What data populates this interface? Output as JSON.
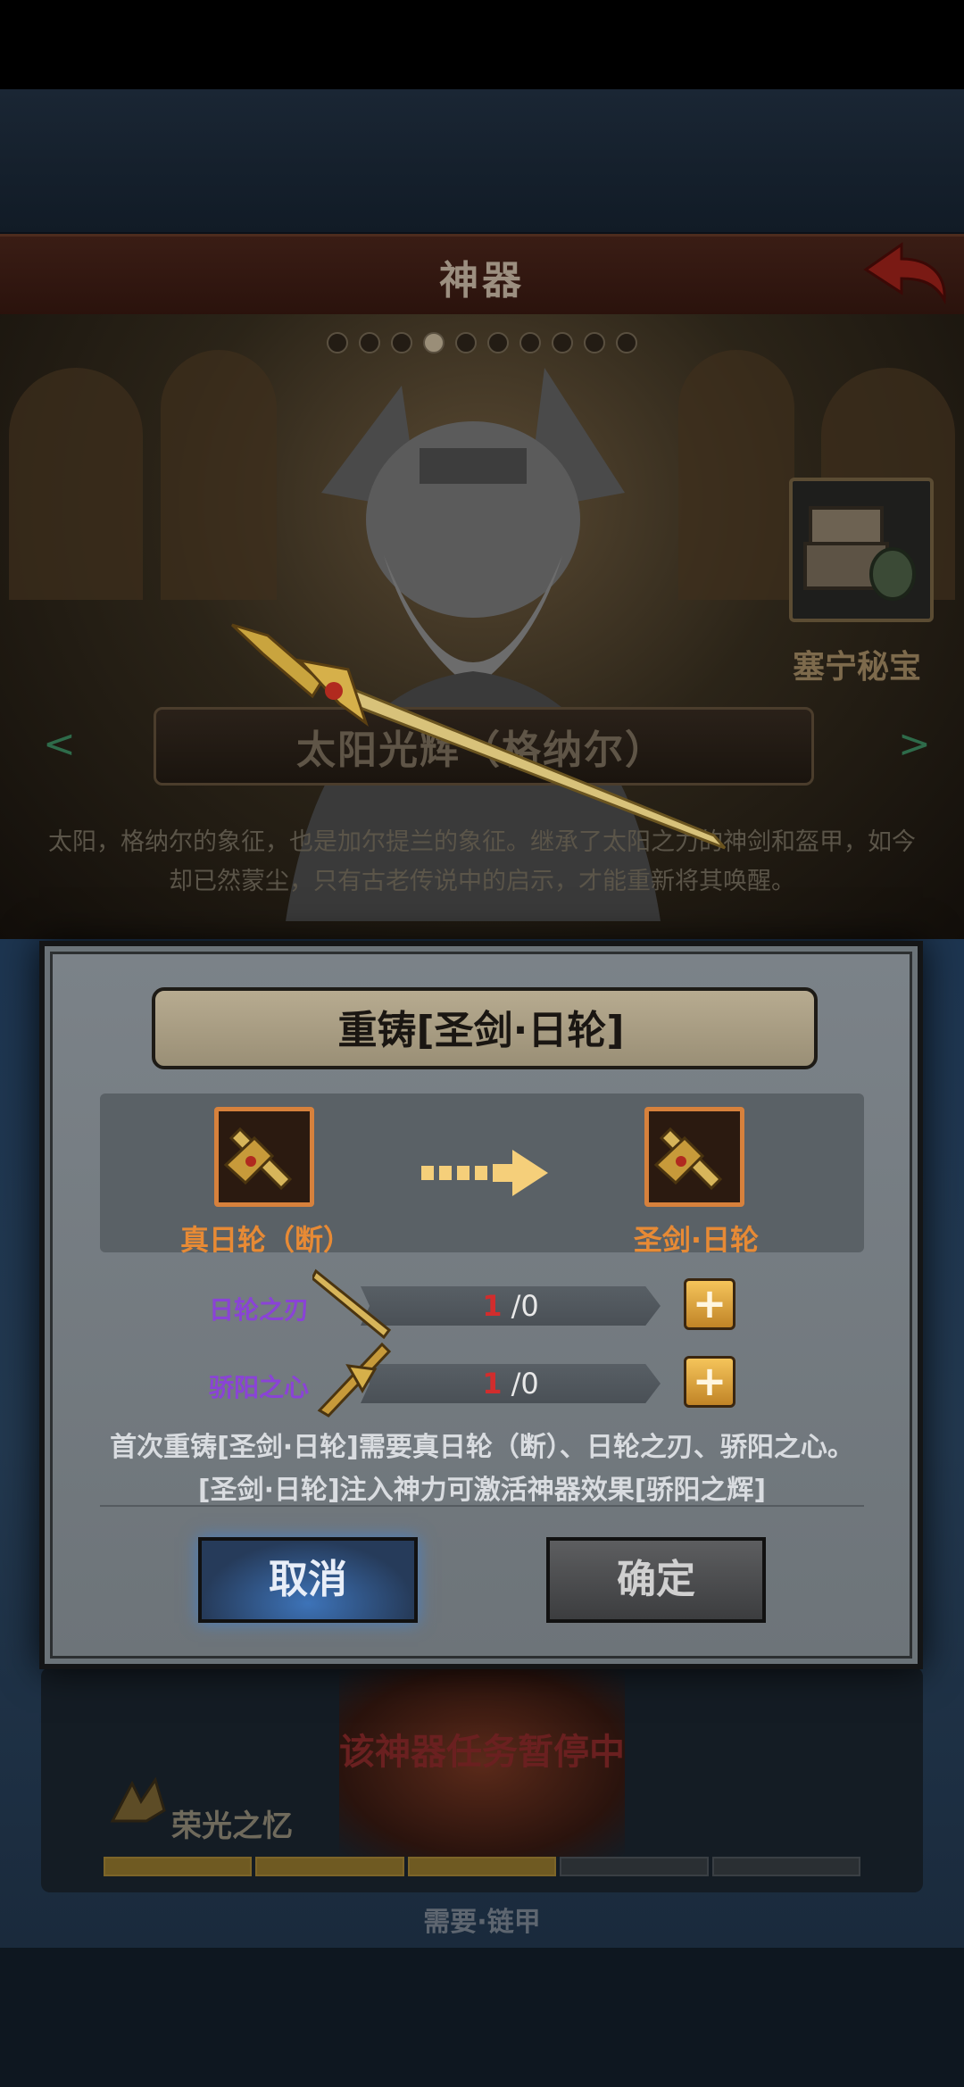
{
  "header": {
    "title": "神器"
  },
  "carousel": {
    "dots": 10,
    "active": 4
  },
  "treasure": {
    "label": "塞宁秘宝"
  },
  "artifact": {
    "name": "太阳光辉（格纳尔）",
    "description_line1": "太阳，格纳尔的象征，也是加尔提兰的象征。继承了太阳之力的神剑和盔甲，如今",
    "description_line2": "却已然蒙尘，只有古老传说中的启示，才能重新将其唤醒。"
  },
  "dialog": {
    "title": "重铸[圣剑·日轮]",
    "from_item": "真日轮（断）",
    "to_item": "圣剑·日轮",
    "materials": [
      {
        "name": "日轮之刃",
        "have": "1",
        "sep": "/",
        "need": "0"
      },
      {
        "name": "骄阳之心",
        "have": "1",
        "sep": "/",
        "need": "0"
      }
    ],
    "desc_line1": "首次重铸[圣剑·日轮]需要真日轮（断）、日轮之刃、骄阳之心。",
    "desc_line2": "[圣剑·日轮]注入神力可激活神器效果[骄阳之辉]",
    "cancel_label": "取消",
    "confirm_label": "确定"
  },
  "mission": {
    "status": "该神器任务暂停中",
    "name": "荣光之忆",
    "progress_segments": 5,
    "progress_filled": 3,
    "requires": "需要·链甲"
  },
  "colors": {
    "accent_orange": "#e78a35",
    "material_purple": "#8a43d6",
    "count_red": "#d12d2d",
    "gold_button": "#f5c45a",
    "cancel_blue": "#3d73b8"
  }
}
